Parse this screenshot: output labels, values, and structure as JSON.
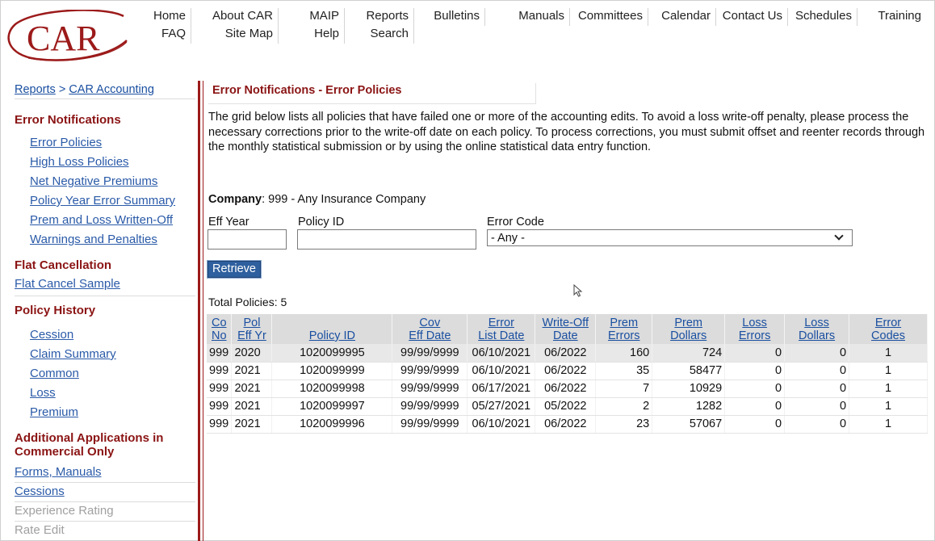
{
  "top_nav": {
    "row1": [
      "Home",
      "About CAR",
      "MAIP",
      "Reports",
      "Bulletins",
      "Manuals",
      "Committees",
      "Calendar",
      "Contact Us",
      "Schedules",
      "Training"
    ],
    "row2": [
      "FAQ",
      "Site Map",
      "Help",
      "Search"
    ]
  },
  "logo": {
    "text": "CAR",
    "color": "#9c1a1a"
  },
  "breadcrumb": {
    "part1": "Reports",
    "separator": ">",
    "part2": "CAR Accounting"
  },
  "sidebar": {
    "error_notifications": {
      "heading": "Error Notifications",
      "items": [
        "Error Policies",
        "High Loss Policies",
        "Net Negative Premiums",
        "Policy Year Error Summary",
        "Prem and Loss Written-Off",
        "Warnings and Penalties"
      ]
    },
    "flat_cancellation": {
      "heading": "Flat Cancellation",
      "items": [
        "Flat Cancel Sample"
      ]
    },
    "policy_history": {
      "heading": "Policy History",
      "items": [
        "Cession",
        "Claim Summary",
        "Common",
        "Loss",
        "Premium"
      ]
    },
    "additional": {
      "heading_line1": "Additional Applications in",
      "heading_line2": "Commercial Only",
      "items": [
        "Forms, Manuals",
        "Cessions",
        "Experience Rating",
        "Rate Edit"
      ]
    }
  },
  "main": {
    "title": "Error Notifications - Error Policies",
    "intro": "The grid below lists all policies that have failed one or more of the accounting edits.  To avoid a loss write-off penalty, please process the necessary corrections prior to the write-off date on each policy.  To process corrections, you must submit offset and reenter records through the monthly statistical submission or by using the online statistical data entry function.",
    "company_label": "Company",
    "company_value": ": 999 - Any Insurance Company",
    "filters": {
      "eff_year_label": "Eff Year",
      "eff_year_value": "",
      "policy_id_label": "Policy ID",
      "policy_id_value": "",
      "error_code_label": "Error Code",
      "error_code_value": "- Any -"
    },
    "retrieve_label": "Retrieve",
    "total_policies": "Total Policies: 5",
    "table": {
      "headers": [
        [
          "Co",
          "No"
        ],
        [
          "Pol",
          "Eff Yr"
        ],
        [
          "Policy ID"
        ],
        [
          "Cov",
          "Eff Date"
        ],
        [
          "Error",
          "List Date"
        ],
        [
          "Write-Off",
          "Date"
        ],
        [
          "Prem",
          "Errors"
        ],
        [
          "Prem",
          "Dollars"
        ],
        [
          "Loss",
          "Errors"
        ],
        [
          "Loss",
          "Dollars"
        ],
        [
          "Error",
          "Codes"
        ]
      ],
      "rows": [
        [
          "999",
          "2020",
          "1020099995",
          "99/99/9999",
          "06/10/2021",
          "06/2022",
          "160",
          "724",
          "0",
          "0",
          "1"
        ],
        [
          "999",
          "2021",
          "1020099999",
          "99/99/9999",
          "06/10/2021",
          "06/2022",
          "35",
          "58477",
          "0",
          "0",
          "1"
        ],
        [
          "999",
          "2021",
          "1020099998",
          "99/99/9999",
          "06/17/2021",
          "06/2022",
          "7",
          "10929",
          "0",
          "0",
          "1"
        ],
        [
          "999",
          "2021",
          "1020099997",
          "99/99/9999",
          "05/27/2021",
          "05/2022",
          "2",
          "1282",
          "0",
          "0",
          "1"
        ],
        [
          "999",
          "2021",
          "1020099996",
          "99/99/9999",
          "06/10/2021",
          "06/2022",
          "23",
          "57067",
          "0",
          "0",
          "1"
        ]
      ]
    }
  },
  "colors": {
    "accent_red": "#8b1414",
    "link_blue": "#1a4fa0",
    "button_blue": "#2e5f9e",
    "header_gray": "#dcdcdc"
  }
}
